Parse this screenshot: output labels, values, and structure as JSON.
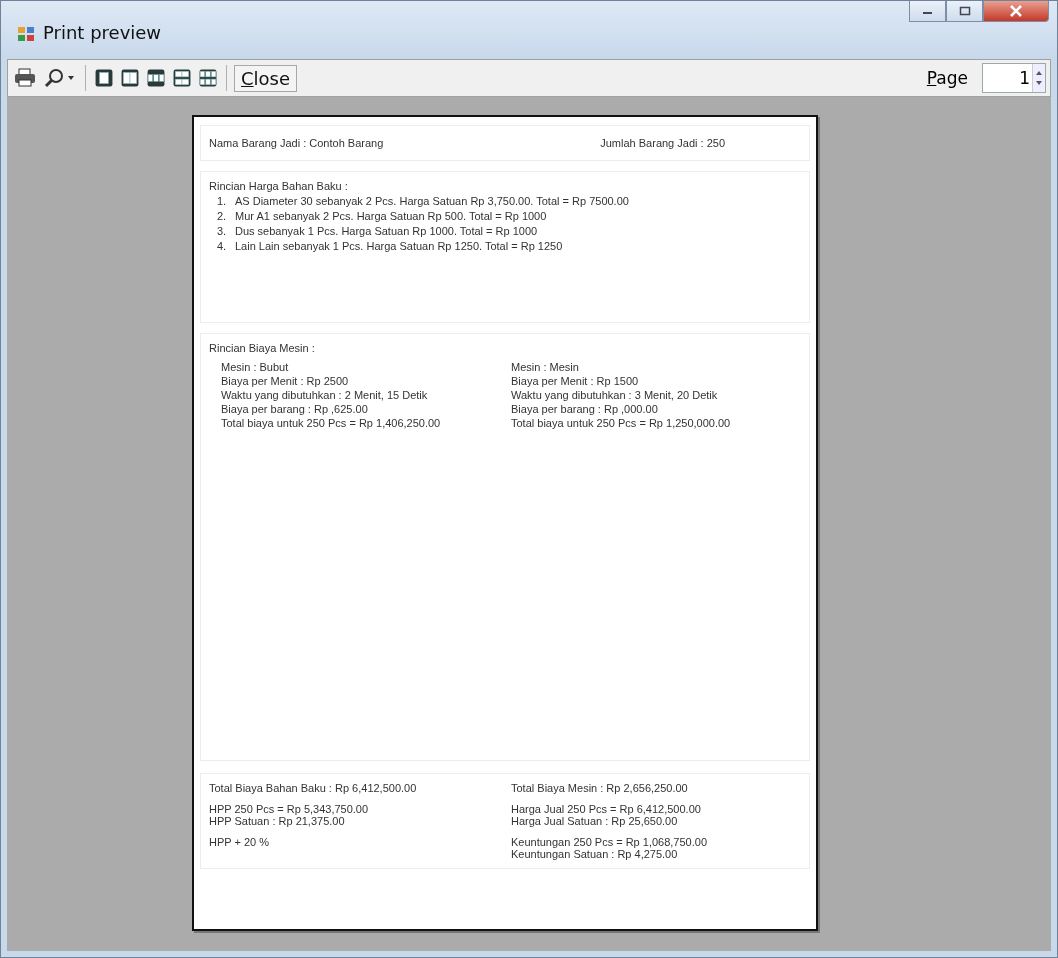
{
  "window": {
    "title": "Print preview"
  },
  "toolbar": {
    "buttons": [
      {
        "kind": "print"
      },
      {
        "kind": "zoom"
      },
      {
        "kind": "one_page"
      },
      {
        "kind": "two_pages"
      },
      {
        "kind": "three_pages"
      },
      {
        "kind": "four_pages"
      },
      {
        "kind": "six_pages"
      }
    ],
    "close_label": "Close",
    "page_label": "Page",
    "page_value": "1"
  },
  "report": {
    "header": {
      "left": "Nama Barang Jadi : Contoh Barang",
      "right": "Jumlah Barang Jadi : 250"
    },
    "materials": {
      "title": "Rincian Harga Bahan Baku :",
      "items": [
        {
          "number": "1.",
          "text": "AS Diameter 30 sebanyak 2 Pcs. Harga Satuan Rp 3,750.00. Total = Rp 7500.00"
        },
        {
          "number": "2.",
          "text": "Mur A1 sebanyak 2 Pcs. Harga Satuan Rp 500. Total = Rp 1000"
        },
        {
          "number": "3.",
          "text": "Dus sebanyak 1 Pcs. Harga Satuan Rp 1000. Total = Rp 1000"
        },
        {
          "number": "4.",
          "text": "Lain Lain sebanyak 1 Pcs. Harga Satuan Rp 1250. Total = Rp 1250"
        }
      ]
    },
    "machines": {
      "title": "Rincian Biaya Mesin :",
      "columns": [
        {
          "lines": [
            "Mesin :  Bubut",
            "Biaya per Menit : Rp  2500",
            "Waktu yang dibutuhkan :  2 Menit, 15 Detik",
            "Biaya per barang : Rp  ,625.00",
            "Total biaya untuk  250 Pcs = Rp 1,406,250.00"
          ]
        },
        {
          "lines": [
            "Mesin :  Mesin",
            "Biaya per Menit : Rp  1500",
            "Waktu yang dibutuhkan :  3 Menit, 20 Detik",
            "Biaya per barang : Rp  ,000.00",
            "Total biaya untuk  250 Pcs = Rp 1,250,000.00"
          ]
        }
      ]
    },
    "summary": {
      "rows": [
        {
          "left": [
            "Total Biaya Bahan Baku : Rp  6,412,500.00"
          ],
          "right": [
            "Total Biaya Mesin : Rp  2,656,250.00"
          ]
        },
        {
          "left": [
            "HPP  250 Pcs = Rp 5,343,750.00",
            "HPP Satuan : Rp  21,375.00"
          ],
          "right": [
            "Harga Jual  250 Pcs = Rp 6,412,500.00",
            "Harga Jual Satuan : Rp  25,650.00"
          ]
        },
        {
          "left": [
            "HPP +  20 %"
          ],
          "right": [
            "Keuntungan  250 Pcs = Rp 1,068,750.00",
            "Keuntungan Satuan : Rp  4,275.00"
          ]
        }
      ]
    }
  }
}
